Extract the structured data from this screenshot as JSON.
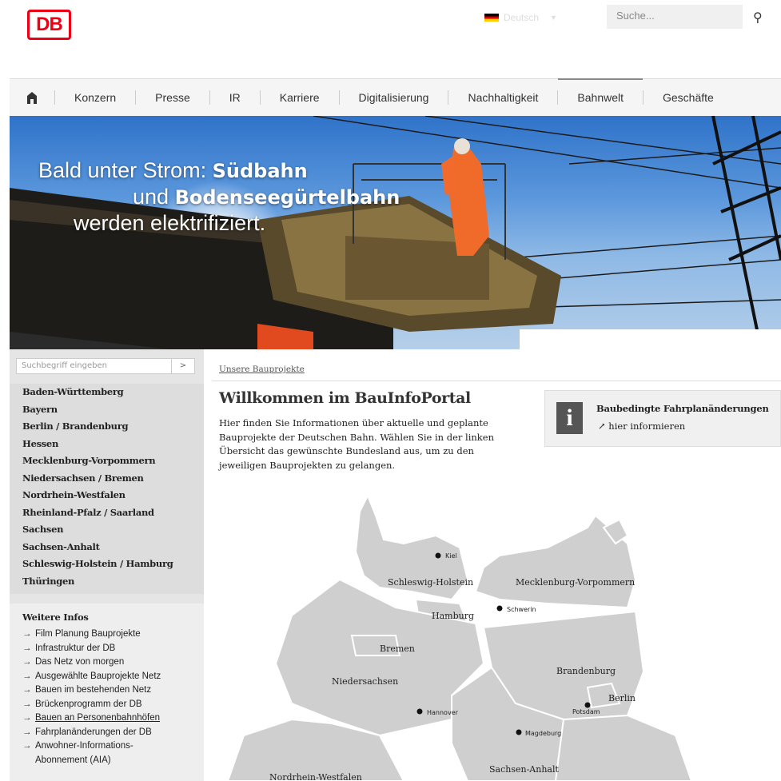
{
  "header": {
    "logo": "DB",
    "language": "Deutsch",
    "search_placeholder": "Suche..."
  },
  "nav": {
    "items": [
      "Konzern",
      "Presse",
      "IR",
      "Karriere",
      "Digitalisierung",
      "Nachhaltigkeit",
      "Bahnwelt",
      "Geschäfte"
    ],
    "active": "Bahnwelt"
  },
  "hero": {
    "line1_regular": "Bald unter Strom: ",
    "line1_bold": "Südbahn",
    "line2_regular": "und ",
    "line2_bold": "Bodenseegürtelbahn",
    "line3": "werden elektrifiziert."
  },
  "sidebar": {
    "search_placeholder": "Suchbegriff eingeben",
    "search_button": ">",
    "states": [
      "Baden-Württemberg",
      "Bayern",
      "Berlin / Brandenburg",
      "Hessen",
      "Mecklenburg-Vorpommern",
      "Niedersachsen / Bremen",
      "Nordrhein-Westfalen",
      "Rheinland-Pfalz / Saarland",
      "Sachsen",
      "Sachsen-Anhalt",
      "Schleswig-Holstein / Hamburg",
      "Thüringen"
    ],
    "weitere_title": "Weitere Infos",
    "weitere_items": [
      "Film Planung Bauprojekte",
      "Infrastruktur der DB",
      "Das Netz von morgen",
      "Ausgewählte Bauprojekte Netz",
      "Bauen im bestehenden Netz",
      "Brückenprogramm der DB",
      "Bauen an Personenbahnhöfen",
      "Fahrplanänderungen der DB",
      "Anwohner-Informations-",
      "Abonnement (AIA)"
    ]
  },
  "main": {
    "breadcrumb": "Unsere Bauprojekte",
    "title": "Willkommen im BauInfoPortal",
    "intro": "Hier finden Sie Informationen über aktuelle und geplante Bauprojekte der Deutschen Bahn. Wählen Sie in der linken Übersicht das gewünschte Bundesland aus, um zu den jeweiligen Bauprojekten zu gelangen.",
    "infobox": {
      "title": "Baubedingte Fahrplanänderungen",
      "link": "hier informieren"
    }
  },
  "map": {
    "regions": [
      "Schleswig-Holstein",
      "Mecklenburg-Vorpommern",
      "Hamburg",
      "Bremen",
      "Brandenburg",
      "Niedersachsen",
      "Berlin",
      "Nordrhein-Westfalen",
      "Sachsen-Anhalt"
    ],
    "cities": [
      "Kiel",
      "Schwerin",
      "Potsdam",
      "Hannover",
      "Magdeburg"
    ]
  }
}
